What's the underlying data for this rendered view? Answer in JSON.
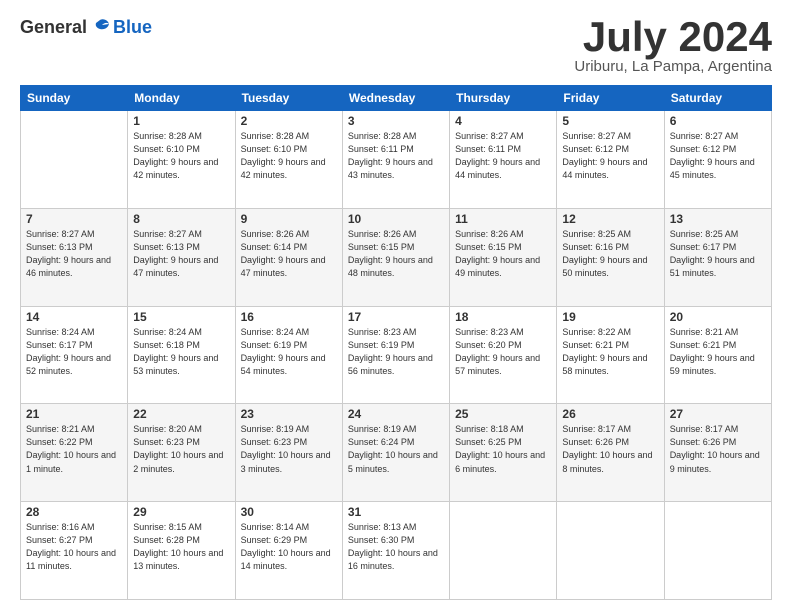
{
  "logo": {
    "general": "General",
    "blue": "Blue"
  },
  "title": "July 2024",
  "subtitle": "Uriburu, La Pampa, Argentina",
  "days_of_week": [
    "Sunday",
    "Monday",
    "Tuesday",
    "Wednesday",
    "Thursday",
    "Friday",
    "Saturday"
  ],
  "weeks": [
    [
      {
        "day": "",
        "sunrise": "",
        "sunset": "",
        "daylight": ""
      },
      {
        "day": "1",
        "sunrise": "Sunrise: 8:28 AM",
        "sunset": "Sunset: 6:10 PM",
        "daylight": "Daylight: 9 hours and 42 minutes."
      },
      {
        "day": "2",
        "sunrise": "Sunrise: 8:28 AM",
        "sunset": "Sunset: 6:10 PM",
        "daylight": "Daylight: 9 hours and 42 minutes."
      },
      {
        "day": "3",
        "sunrise": "Sunrise: 8:28 AM",
        "sunset": "Sunset: 6:11 PM",
        "daylight": "Daylight: 9 hours and 43 minutes."
      },
      {
        "day": "4",
        "sunrise": "Sunrise: 8:27 AM",
        "sunset": "Sunset: 6:11 PM",
        "daylight": "Daylight: 9 hours and 44 minutes."
      },
      {
        "day": "5",
        "sunrise": "Sunrise: 8:27 AM",
        "sunset": "Sunset: 6:12 PM",
        "daylight": "Daylight: 9 hours and 44 minutes."
      },
      {
        "day": "6",
        "sunrise": "Sunrise: 8:27 AM",
        "sunset": "Sunset: 6:12 PM",
        "daylight": "Daylight: 9 hours and 45 minutes."
      }
    ],
    [
      {
        "day": "7",
        "sunrise": "Sunrise: 8:27 AM",
        "sunset": "Sunset: 6:13 PM",
        "daylight": "Daylight: 9 hours and 46 minutes."
      },
      {
        "day": "8",
        "sunrise": "Sunrise: 8:27 AM",
        "sunset": "Sunset: 6:13 PM",
        "daylight": "Daylight: 9 hours and 47 minutes."
      },
      {
        "day": "9",
        "sunrise": "Sunrise: 8:26 AM",
        "sunset": "Sunset: 6:14 PM",
        "daylight": "Daylight: 9 hours and 47 minutes."
      },
      {
        "day": "10",
        "sunrise": "Sunrise: 8:26 AM",
        "sunset": "Sunset: 6:15 PM",
        "daylight": "Daylight: 9 hours and 48 minutes."
      },
      {
        "day": "11",
        "sunrise": "Sunrise: 8:26 AM",
        "sunset": "Sunset: 6:15 PM",
        "daylight": "Daylight: 9 hours and 49 minutes."
      },
      {
        "day": "12",
        "sunrise": "Sunrise: 8:25 AM",
        "sunset": "Sunset: 6:16 PM",
        "daylight": "Daylight: 9 hours and 50 minutes."
      },
      {
        "day": "13",
        "sunrise": "Sunrise: 8:25 AM",
        "sunset": "Sunset: 6:17 PM",
        "daylight": "Daylight: 9 hours and 51 minutes."
      }
    ],
    [
      {
        "day": "14",
        "sunrise": "Sunrise: 8:24 AM",
        "sunset": "Sunset: 6:17 PM",
        "daylight": "Daylight: 9 hours and 52 minutes."
      },
      {
        "day": "15",
        "sunrise": "Sunrise: 8:24 AM",
        "sunset": "Sunset: 6:18 PM",
        "daylight": "Daylight: 9 hours and 53 minutes."
      },
      {
        "day": "16",
        "sunrise": "Sunrise: 8:24 AM",
        "sunset": "Sunset: 6:19 PM",
        "daylight": "Daylight: 9 hours and 54 minutes."
      },
      {
        "day": "17",
        "sunrise": "Sunrise: 8:23 AM",
        "sunset": "Sunset: 6:19 PM",
        "daylight": "Daylight: 9 hours and 56 minutes."
      },
      {
        "day": "18",
        "sunrise": "Sunrise: 8:23 AM",
        "sunset": "Sunset: 6:20 PM",
        "daylight": "Daylight: 9 hours and 57 minutes."
      },
      {
        "day": "19",
        "sunrise": "Sunrise: 8:22 AM",
        "sunset": "Sunset: 6:21 PM",
        "daylight": "Daylight: 9 hours and 58 minutes."
      },
      {
        "day": "20",
        "sunrise": "Sunrise: 8:21 AM",
        "sunset": "Sunset: 6:21 PM",
        "daylight": "Daylight: 9 hours and 59 minutes."
      }
    ],
    [
      {
        "day": "21",
        "sunrise": "Sunrise: 8:21 AM",
        "sunset": "Sunset: 6:22 PM",
        "daylight": "Daylight: 10 hours and 1 minute."
      },
      {
        "day": "22",
        "sunrise": "Sunrise: 8:20 AM",
        "sunset": "Sunset: 6:23 PM",
        "daylight": "Daylight: 10 hours and 2 minutes."
      },
      {
        "day": "23",
        "sunrise": "Sunrise: 8:19 AM",
        "sunset": "Sunset: 6:23 PM",
        "daylight": "Daylight: 10 hours and 3 minutes."
      },
      {
        "day": "24",
        "sunrise": "Sunrise: 8:19 AM",
        "sunset": "Sunset: 6:24 PM",
        "daylight": "Daylight: 10 hours and 5 minutes."
      },
      {
        "day": "25",
        "sunrise": "Sunrise: 8:18 AM",
        "sunset": "Sunset: 6:25 PM",
        "daylight": "Daylight: 10 hours and 6 minutes."
      },
      {
        "day": "26",
        "sunrise": "Sunrise: 8:17 AM",
        "sunset": "Sunset: 6:26 PM",
        "daylight": "Daylight: 10 hours and 8 minutes."
      },
      {
        "day": "27",
        "sunrise": "Sunrise: 8:17 AM",
        "sunset": "Sunset: 6:26 PM",
        "daylight": "Daylight: 10 hours and 9 minutes."
      }
    ],
    [
      {
        "day": "28",
        "sunrise": "Sunrise: 8:16 AM",
        "sunset": "Sunset: 6:27 PM",
        "daylight": "Daylight: 10 hours and 11 minutes."
      },
      {
        "day": "29",
        "sunrise": "Sunrise: 8:15 AM",
        "sunset": "Sunset: 6:28 PM",
        "daylight": "Daylight: 10 hours and 13 minutes."
      },
      {
        "day": "30",
        "sunrise": "Sunrise: 8:14 AM",
        "sunset": "Sunset: 6:29 PM",
        "daylight": "Daylight: 10 hours and 14 minutes."
      },
      {
        "day": "31",
        "sunrise": "Sunrise: 8:13 AM",
        "sunset": "Sunset: 6:30 PM",
        "daylight": "Daylight: 10 hours and 16 minutes."
      },
      {
        "day": "",
        "sunrise": "",
        "sunset": "",
        "daylight": ""
      },
      {
        "day": "",
        "sunrise": "",
        "sunset": "",
        "daylight": ""
      },
      {
        "day": "",
        "sunrise": "",
        "sunset": "",
        "daylight": ""
      }
    ]
  ]
}
